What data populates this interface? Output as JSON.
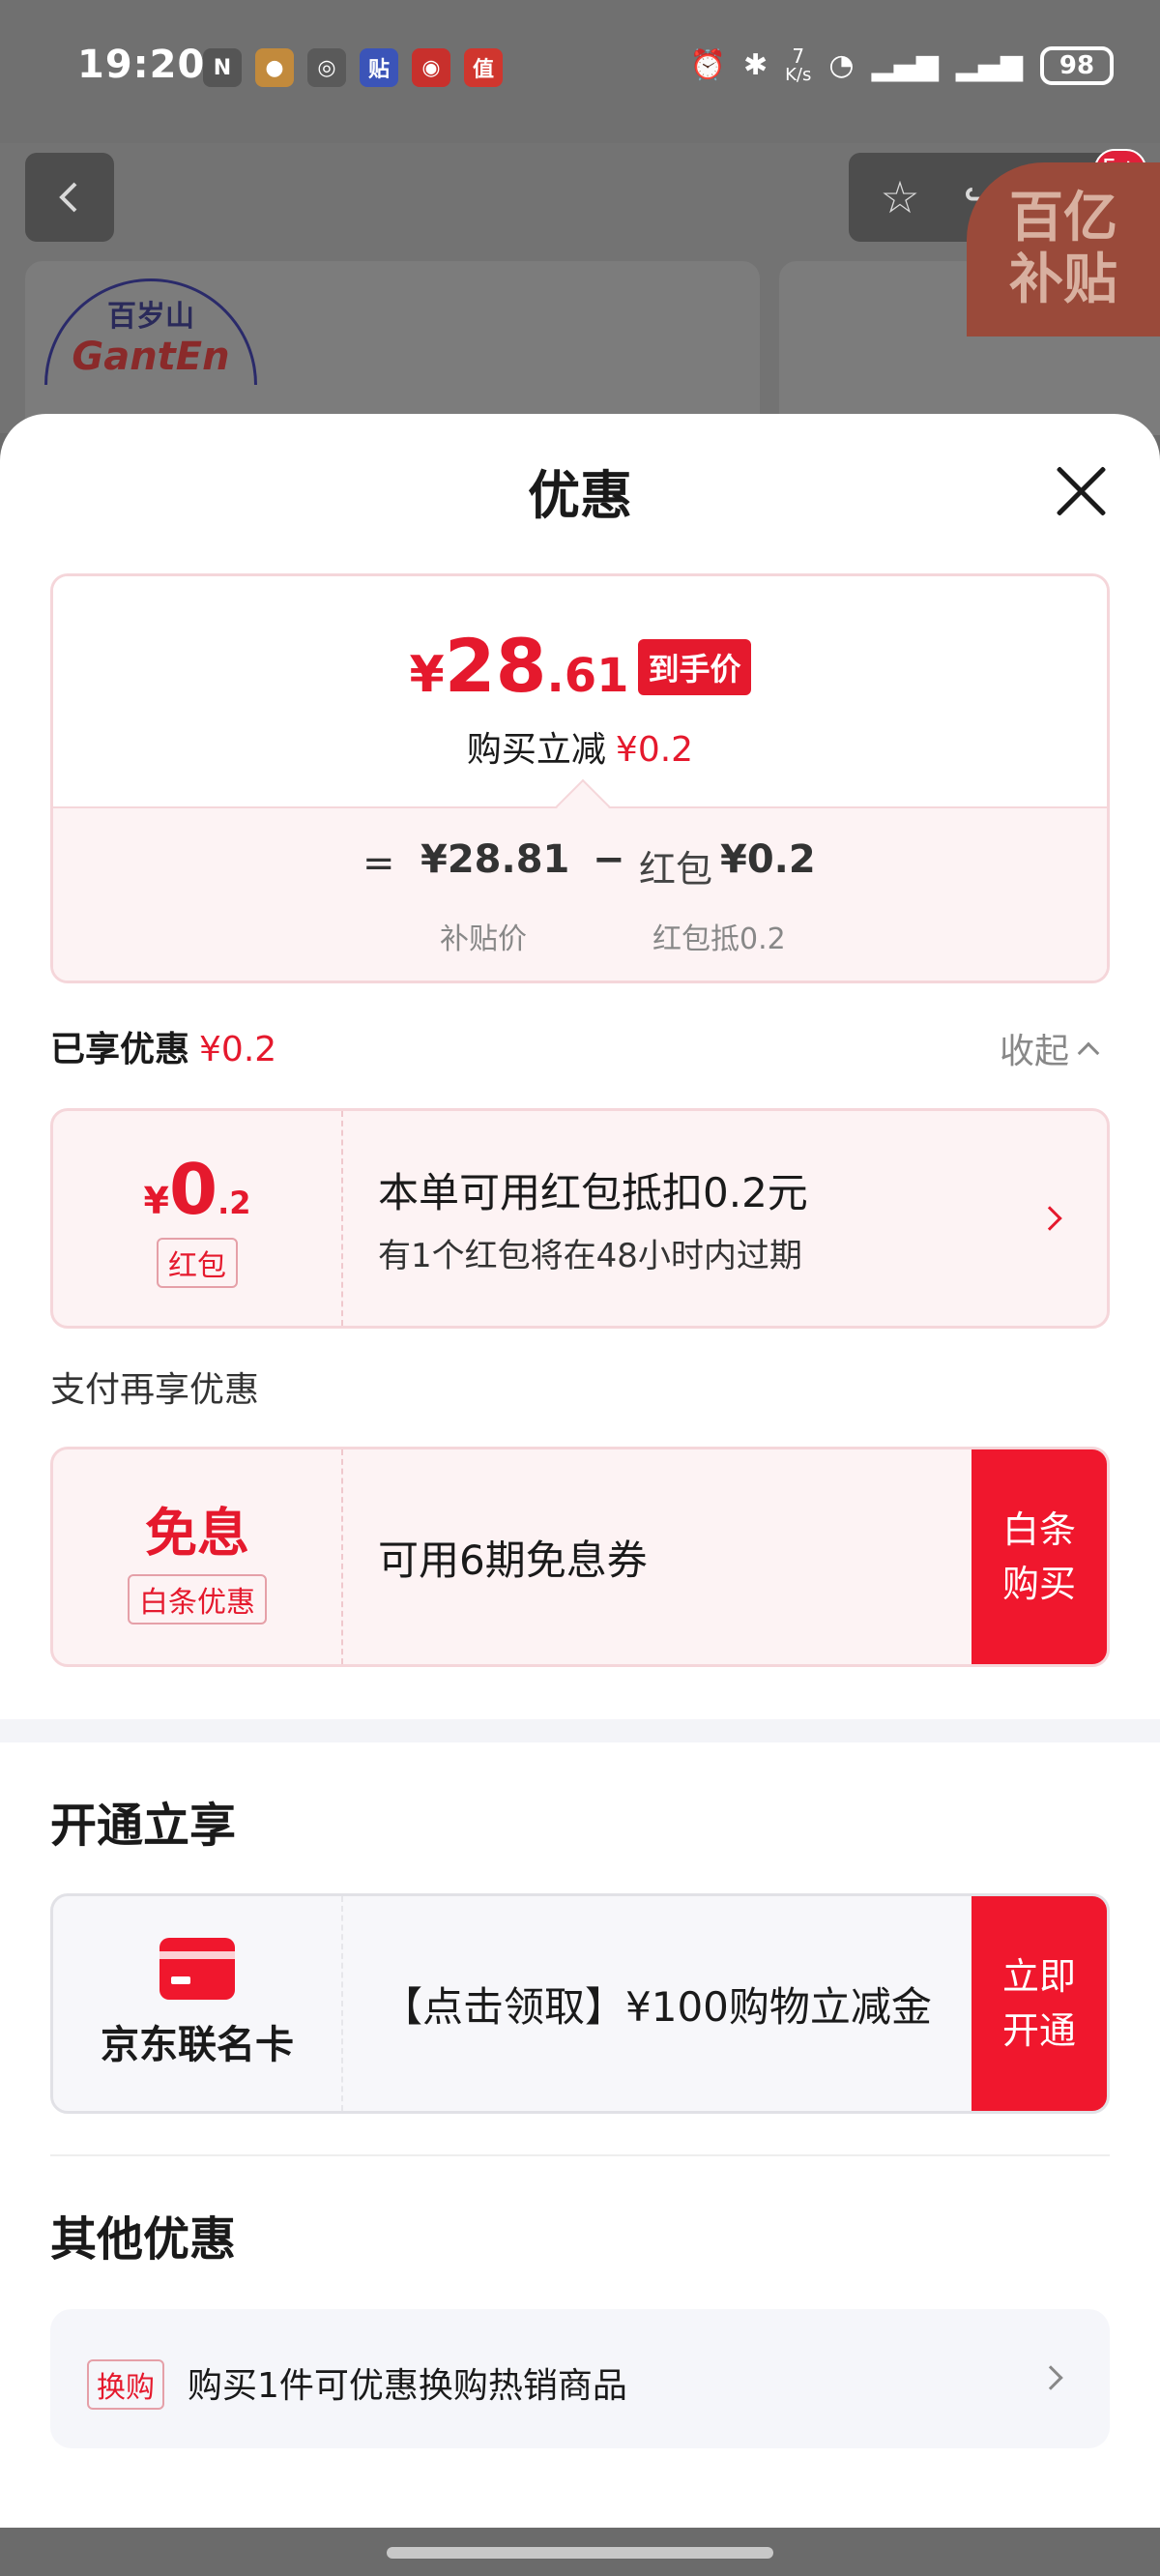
{
  "status_bar": {
    "time": "19:20",
    "notification_icons": [
      "nfc-icon",
      "app-icon",
      "wechat-icon",
      "tie-icon",
      "app-icon",
      "zhi-icon"
    ],
    "tie_glyph": "贴",
    "zhi_glyph": "值",
    "net_speed_value": "7",
    "net_speed_unit": "K/s",
    "battery": "98"
  },
  "background": {
    "badge": "5+",
    "brand_cn": "百岁山",
    "brand_en": "GantEn",
    "promo_line1": "百亿",
    "promo_line2": "补贴"
  },
  "sheet": {
    "title": "优惠",
    "price_card": {
      "currency": "¥",
      "price_int": "28",
      "price_dec": ".61",
      "price_tag": "到手价",
      "reduce_label": "购买立减",
      "reduce_value": "¥0.2",
      "equals": "=",
      "subsidy_price": "¥28.81",
      "minus": "−",
      "red_packet_label": "红包",
      "red_packet_value": "¥0.2",
      "caption_subsidy": "补贴价",
      "caption_red_packet": "红包抵0.2"
    },
    "enjoyed": {
      "label": "已享优惠",
      "value": "¥0.2",
      "collapse": "收起"
    },
    "red_packet_coupon": {
      "currency": "¥",
      "amount_int": "0",
      "amount_dec": ".2",
      "chip": "红包",
      "title": "本单可用红包抵扣0.2元",
      "subtitle": "有1个红包将在48小时内过期"
    },
    "pay_more_label": "支付再享优惠",
    "baitiao_coupon": {
      "headline": "免息",
      "chip": "白条优惠",
      "title": "可用6期免息券",
      "button_line1": "白条",
      "button_line2": "购买"
    },
    "open_section": {
      "title": "开通立享",
      "card_name": "京东联名卡",
      "offer": "【点击领取】¥100购物立减金",
      "button_line1": "立即",
      "button_line2": "开通"
    },
    "other_section": {
      "title": "其他优惠",
      "tag": "换购",
      "text": "购买1件可优惠换购热销商品"
    }
  },
  "colors": {
    "accent_red": "#e5192d",
    "button_red": "#f0172d",
    "coupon_bg": "#fdf3f4",
    "coupon_border": "#f5d6da"
  }
}
